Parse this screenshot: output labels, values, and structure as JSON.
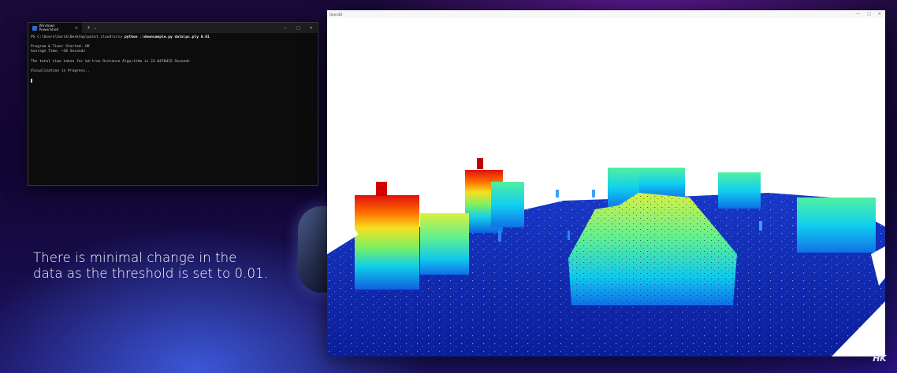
{
  "terminal": {
    "tab_title": "Windows PowerShell",
    "tab_close": "×",
    "new_tab": "+",
    "dropdown": "⌄",
    "minimize": "—",
    "maximize": "□",
    "close": "✕",
    "prompt": "PS C:\\Users\\harik\\Desktop\\point_cloud\\src> ",
    "command": "python .\\downsample.py data\\pc.ply 0.01",
    "lines": {
      "l1": "Program & Timer Started..OK",
      "l2": "Average Time: ~20 Seconds",
      "l3": "The total time taken for kd-tree Distance Algorithm is 22.0478415 Seconds",
      "l4": "Visualization in Progress.."
    }
  },
  "caption": {
    "line1": "There is minimal change in the",
    "line2": "data as the threshold is set to 0.01."
  },
  "viewer": {
    "title": "Open3D",
    "minimize": "—",
    "maximize": "□",
    "close": "✕"
  },
  "watermark": "HK"
}
